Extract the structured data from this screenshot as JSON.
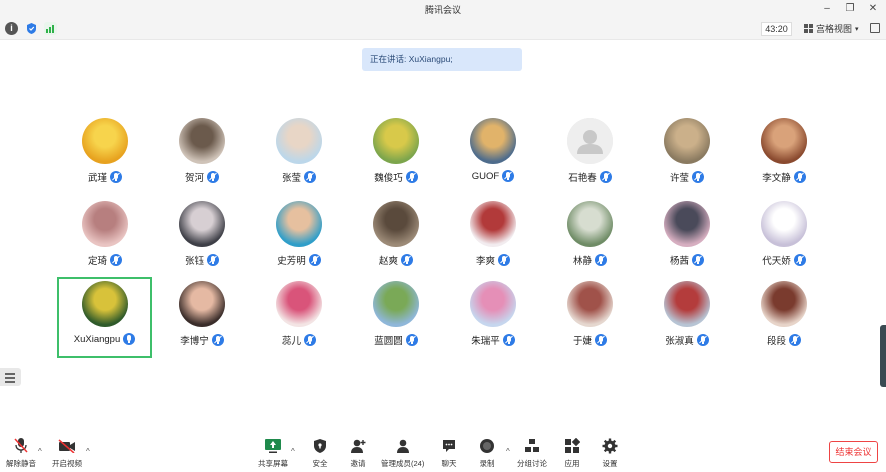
{
  "window": {
    "title": "腾讯会议"
  },
  "status": {
    "timer": "43:20",
    "view_label": "宫格视图"
  },
  "speaking": {
    "text": "正在讲话: XuXiangpu;"
  },
  "participants": [
    {
      "name": "武瑾",
      "bg": "#e7a21f",
      "fg": "#f7d44c"
    },
    {
      "name": "贺河",
      "bg": "#cfc3b8",
      "fg": "#6b5a4c"
    },
    {
      "name": "张莹",
      "bg": "#bcd7ea",
      "fg": "#e8d6c6"
    },
    {
      "name": "魏俊巧",
      "bg": "#7ca54c",
      "fg": "#d8c94a"
    },
    {
      "name": "GUOF",
      "bg": "#4e6c8c",
      "fg": "#e1b36a"
    },
    {
      "name": "石艳春",
      "bg": "#eeeeee",
      "fg": "#c8c8c8"
    },
    {
      "name": "许莹",
      "bg": "#8a7a60",
      "fg": "#cbb08a"
    },
    {
      "name": "李文静",
      "bg": "#8a4a2f",
      "fg": "#d9a27a"
    },
    {
      "name": "定琦",
      "bg": "#e9c4c2",
      "fg": "#b77f7f"
    },
    {
      "name": "张钰",
      "bg": "#3e3f47",
      "fg": "#d7cfd3"
    },
    {
      "name": "史芳明",
      "bg": "#2f9ec9",
      "fg": "#e6c09f"
    },
    {
      "name": "赵爽",
      "bg": "#9c8a77",
      "fg": "#5a4a3c"
    },
    {
      "name": "李爽",
      "bg": "#f2ecef",
      "fg": "#b23a3a"
    },
    {
      "name": "林静",
      "bg": "#6f8c66",
      "fg": "#d7ddd0"
    },
    {
      "name": "杨茜",
      "bg": "#d6aec0",
      "fg": "#4a4a5a"
    },
    {
      "name": "代天娇",
      "bg": "#c7c0d8",
      "fg": "#ffffff"
    },
    {
      "name": "XuXiangpu",
      "bg": "#2f5a2a",
      "fg": "#d8c23a"
    },
    {
      "name": "李博宁",
      "bg": "#3a2d2a",
      "fg": "#e5b9a3"
    },
    {
      "name": "蕊儿",
      "bg": "#f3e4e4",
      "fg": "#d9547a"
    },
    {
      "name": "蓝圆圆",
      "bg": "#8fb7d9",
      "fg": "#7aa957"
    },
    {
      "name": "朱瑞平",
      "bg": "#c6d6ee",
      "fg": "#e58fb7"
    },
    {
      "name": "于婕",
      "bg": "#e5d7cf",
      "fg": "#a0524a"
    },
    {
      "name": "张淑真",
      "bg": "#b7c4d4",
      "fg": "#b43c3c"
    },
    {
      "name": "段段",
      "bg": "#e7d4c9",
      "fg": "#7a3b2e"
    }
  ],
  "toolbar": {
    "mute": "解除静音",
    "video": "开启视频",
    "share": "共享屏幕",
    "security": "安全",
    "invite": "邀请",
    "members": "管理成员(24)",
    "chat": "聊天",
    "record": "录制",
    "breakout": "分组讨论",
    "apps": "应用",
    "settings": "设置",
    "end": "结束会议"
  },
  "colors": {
    "accent": "#2e7be6",
    "active_border": "#3dbf6a",
    "end": "#e33333"
  }
}
